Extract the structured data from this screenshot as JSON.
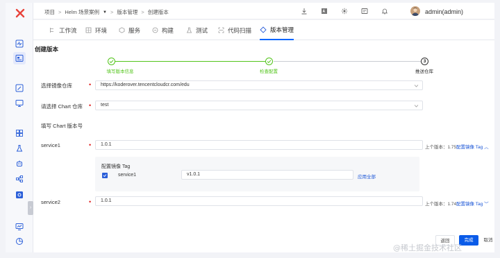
{
  "breadcrumb": {
    "items": [
      "项目",
      "Helm 场景案例",
      "版本管理",
      "创建版本"
    ]
  },
  "user": {
    "name": "admin(admin)"
  },
  "tabs": [
    {
      "label": "工作流",
      "icon": "workflow-icon"
    },
    {
      "label": "环境",
      "icon": "environment-icon"
    },
    {
      "label": "服务",
      "icon": "service-icon"
    },
    {
      "label": "构建",
      "icon": "build-icon"
    },
    {
      "label": "测试",
      "icon": "test-icon"
    },
    {
      "label": "代码扫描",
      "icon": "scan-icon"
    },
    {
      "label": "版本管理",
      "icon": "version-icon",
      "active": true
    }
  ],
  "page": {
    "title": "创建版本"
  },
  "steps": [
    {
      "label": "填写版本信息",
      "state": "done"
    },
    {
      "label": "检查配置",
      "state": "done"
    },
    {
      "label": "推送仓库",
      "state": "current",
      "number": "3"
    }
  ],
  "form": {
    "image_registry": {
      "label": "选择镜像仓库",
      "value": "https://koderover.tencentcloudcr.com/edu"
    },
    "chart_repo": {
      "label": "请选择 Chart 仓库",
      "value": "test"
    },
    "chart_version_heading": "填写 Chart 版本号",
    "services": [
      {
        "name": "service1",
        "value": "1.0.1",
        "prev_version": "上个版本：1.75",
        "config_link": "配置镜像 Tag",
        "expanded": true
      },
      {
        "name": "service2",
        "value": "1.0.1",
        "prev_version": "上个版本：1.74",
        "config_link": "配置镜像 Tag",
        "expanded": false
      }
    ],
    "tag_config": {
      "title": "配置镜像 Tag",
      "row_service": "service1",
      "row_value": "v1.0.1",
      "apply_all": "应用全部",
      "checked": true
    }
  },
  "actions": {
    "back": "返回",
    "done": "完成",
    "cancel": "取消"
  },
  "watermark": "@稀土掘金技术社区",
  "colors": {
    "primary": "#0a5be8",
    "success": "#52c41a",
    "required": "#e02020",
    "link": "#1a55d6"
  }
}
